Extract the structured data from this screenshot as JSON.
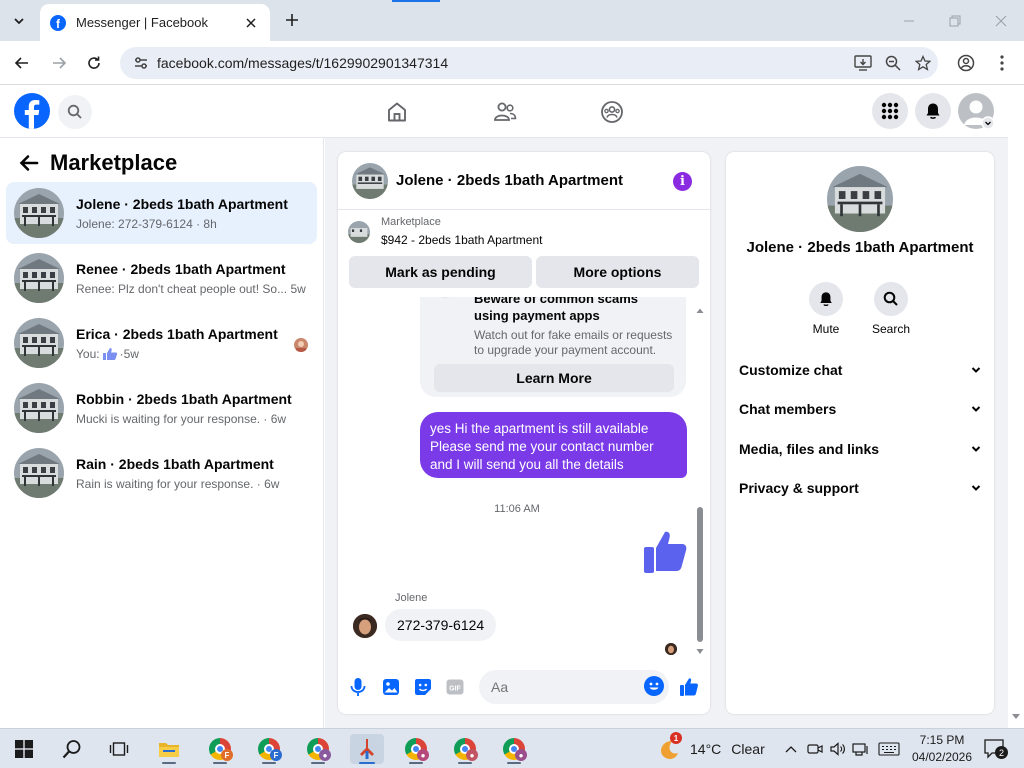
{
  "browser": {
    "tab_title": "Messenger | Facebook",
    "url": "facebook.com/messages/t/1629902901347314"
  },
  "marketplace_list": {
    "title": "Marketplace",
    "conversations": [
      {
        "name": "Jolene · 2beds 1bath Apartment",
        "preview": "Jolene: 272-379-6124 · 8h",
        "active": true
      },
      {
        "name": "Renee · 2beds 1bath Apartment",
        "preview": "Renee: Plz don't cheat people out! So...",
        "time": "5w"
      },
      {
        "name": "Erica · 2beds 1bath Apartment",
        "preview_prefix": "You:",
        "time": "5w"
      },
      {
        "name": "Robbin · 2beds 1bath Apartment",
        "preview": "Mucki is waiting for your response. · 6w"
      },
      {
        "name": "Rain · 2beds 1bath Apartment",
        "preview": "Rain is waiting for your response. · 6w"
      }
    ]
  },
  "chat": {
    "title": "Jolene · 2beds 1bath Apartment",
    "listing_label": "Marketplace",
    "listing_value": "$942 - 2beds 1bath Apartment",
    "mark_pending_label": "Mark as pending",
    "more_options_label": "More options",
    "scam_heading": "Beware of common scams using payment apps",
    "scam_body": "Watch out for fake emails or requests to upgrade your payment account.",
    "learn_more_label": "Learn More",
    "outgoing_message": "yes Hi the apartment is still available Please send me your contact number and I will send you all the details",
    "timestamp": "11:06 AM",
    "sender_name": "Jolene",
    "incoming_message": "272-379-6124",
    "input_placeholder": "Aa"
  },
  "details": {
    "name": "Jolene · 2beds 1bath Apartment",
    "mute_label": "Mute",
    "search_label": "Search",
    "sections": [
      "Customize chat",
      "Chat members",
      "Media, files and links",
      "Privacy & support"
    ]
  },
  "taskbar": {
    "temperature": "14°C",
    "condition": "Clear",
    "weather_badge": "1",
    "time": "7:15 PM",
    "date": "04/02/2026",
    "notification_count": "2"
  },
  "colors": {
    "facebook_blue": "#0866ff",
    "messenger_purple": "#7a3ae8",
    "active_row": "#e7f0fd"
  }
}
